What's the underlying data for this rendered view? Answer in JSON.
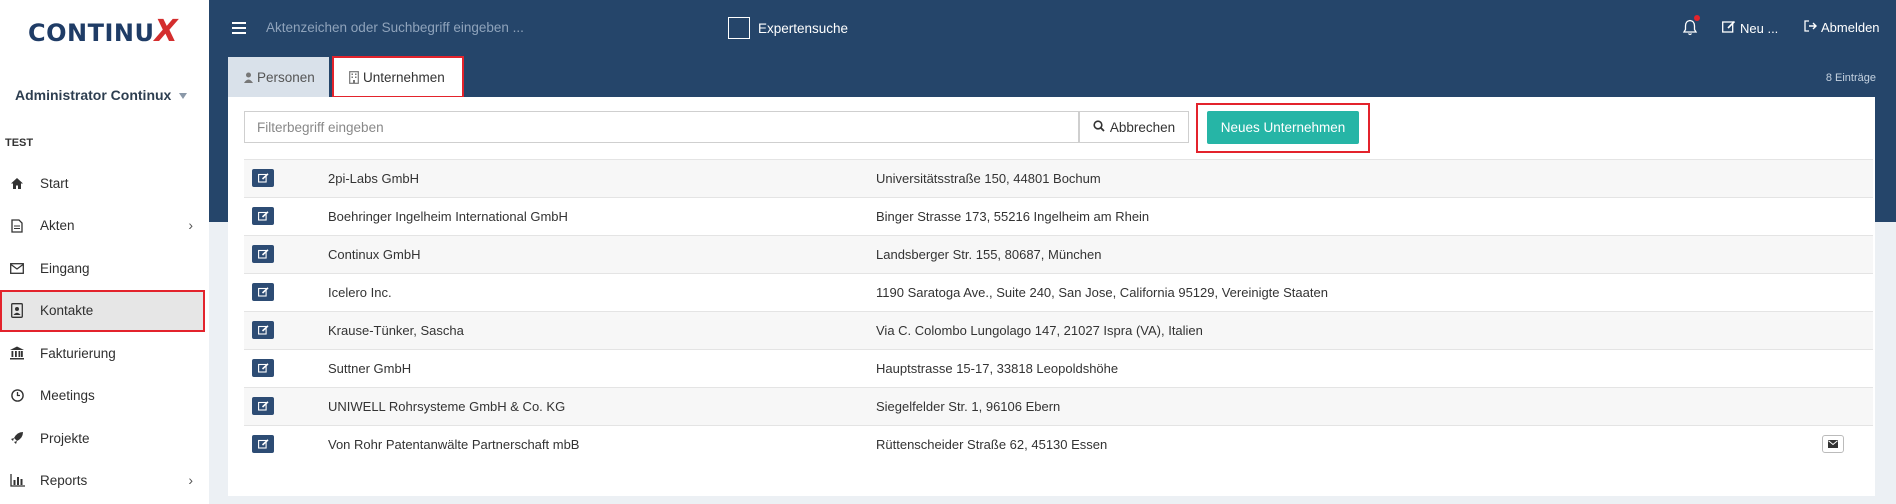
{
  "logo": {
    "text": "CONTINU",
    "x": "X"
  },
  "user": {
    "name": "Administrator Continux"
  },
  "section_label": "TEST",
  "nav": [
    {
      "label": "Start",
      "icon": "home-icon",
      "chevron": false
    },
    {
      "label": "Akten",
      "icon": "file-icon",
      "chevron": true
    },
    {
      "label": "Eingang",
      "icon": "envelope-icon",
      "chevron": false
    },
    {
      "label": "Kontakte",
      "icon": "contact-card-icon",
      "chevron": false,
      "active": true
    },
    {
      "label": "Fakturierung",
      "icon": "bank-icon",
      "chevron": false
    },
    {
      "label": "Meetings",
      "icon": "clock-icon",
      "chevron": false
    },
    {
      "label": "Projekte",
      "icon": "rocket-icon",
      "chevron": false
    },
    {
      "label": "Reports",
      "icon": "bar-chart-icon",
      "chevron": true
    }
  ],
  "header": {
    "search_placeholder": "Aktenzeichen oder Suchbegriff eingeben ...",
    "expert_search": "Expertensuche",
    "new_label": "Neu ...",
    "logout_label": "Abmelden"
  },
  "tabs": [
    {
      "label": "Personen"
    },
    {
      "label": "Unternehmen"
    }
  ],
  "entries_count": "8 Einträge",
  "filter": {
    "placeholder": "Filterbegriff eingeben",
    "cancel": "Abbrechen"
  },
  "new_company_button": "Neues Unternehmen",
  "companies": [
    {
      "name": "2pi-Labs GmbH",
      "address": "Universitätsstraße 150, 44801 Bochum"
    },
    {
      "name": "Boehringer Ingelheim International GmbH",
      "address": "Binger Strasse 173, 55216 Ingelheim am Rhein"
    },
    {
      "name": "Continux GmbH",
      "address": "Landsberger Str. 155, 80687, München"
    },
    {
      "name": "Icelero Inc.",
      "address": "1190 Saratoga Ave., Suite 240, San Jose, California 95129, Vereinigte Staaten"
    },
    {
      "name": "Krause-Tünker, Sascha",
      "address": "Via C. Colombo Lungolago 147, 21027 Ispra (VA), Italien"
    },
    {
      "name": "Suttner GmbH",
      "address": "Hauptstrasse 15-17, 33818 Leopoldshöhe"
    },
    {
      "name": "UNIWELL Rohrsysteme GmbH & Co. KG",
      "address": "Siegelfelder Str. 1, 96106 Ebern"
    },
    {
      "name": "Von Rohr Patentanwälte Partnerschaft mbB",
      "address": "Rüttenscheider Straße 62, 45130 Essen"
    }
  ],
  "colors": {
    "header": "#25456a",
    "accent": "#26b5a6",
    "highlight": "#e3232c"
  }
}
